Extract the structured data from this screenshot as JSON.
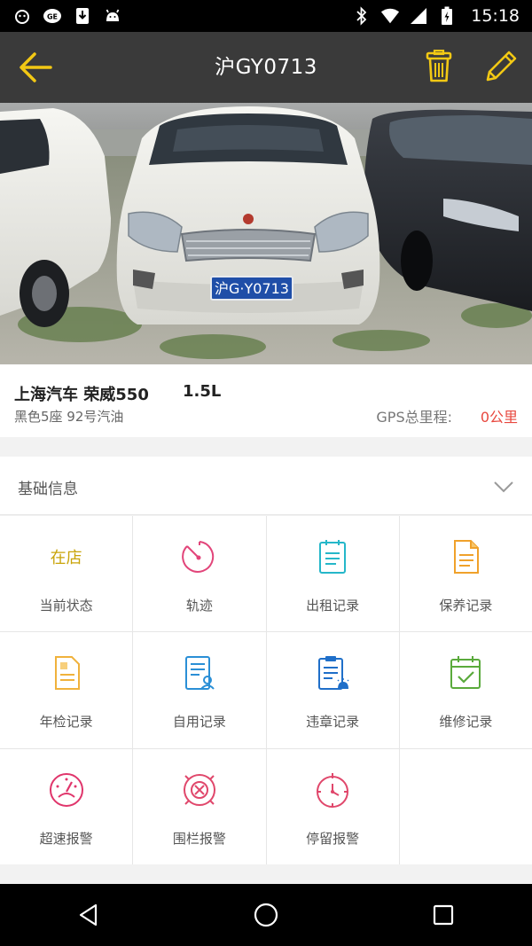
{
  "status_bar": {
    "time": "15:18",
    "icons": [
      "cat-icon",
      "gmail-icon",
      "download-icon",
      "android-icon",
      "bluetooth-icon",
      "wifi-icon",
      "signal-icon",
      "battery-icon"
    ]
  },
  "app_bar": {
    "title": "沪GY0713",
    "icons": [
      "back-arrow-icon",
      "trash-icon",
      "pencil-icon"
    ],
    "accent_color": "#f2c814"
  },
  "car": {
    "model": "上海汽车 荣威550",
    "engine": "1.5L",
    "spec": "黑色5座 92号汽油",
    "gps_label": "GPS总里程:",
    "gps_value": "0公里",
    "plate": "沪G·Y0713"
  },
  "section": {
    "title": "基础信息",
    "icon": "chevron-down-icon"
  },
  "features": [
    {
      "label": "当前状态",
      "status": "在店"
    },
    {
      "label": "轨迹",
      "icon": "track-icon"
    },
    {
      "label": "出租记录",
      "icon": "clipboard-icon"
    },
    {
      "label": "保养记录",
      "icon": "document-icon"
    },
    {
      "label": "年检记录",
      "icon": "file-icon"
    },
    {
      "label": "自用记录",
      "icon": "user-list-icon"
    },
    {
      "label": "违章记录",
      "icon": "violation-icon"
    },
    {
      "label": "维修记录",
      "icon": "calendar-check-icon"
    },
    {
      "label": "超速报警",
      "icon": "speedometer-icon"
    },
    {
      "label": "围栏报警",
      "icon": "fence-icon"
    },
    {
      "label": "停留报警",
      "icon": "stopwatch-icon"
    }
  ],
  "nav_bar": {
    "icons": [
      "back-triangle-icon",
      "home-circle-icon",
      "recents-square-icon"
    ]
  }
}
